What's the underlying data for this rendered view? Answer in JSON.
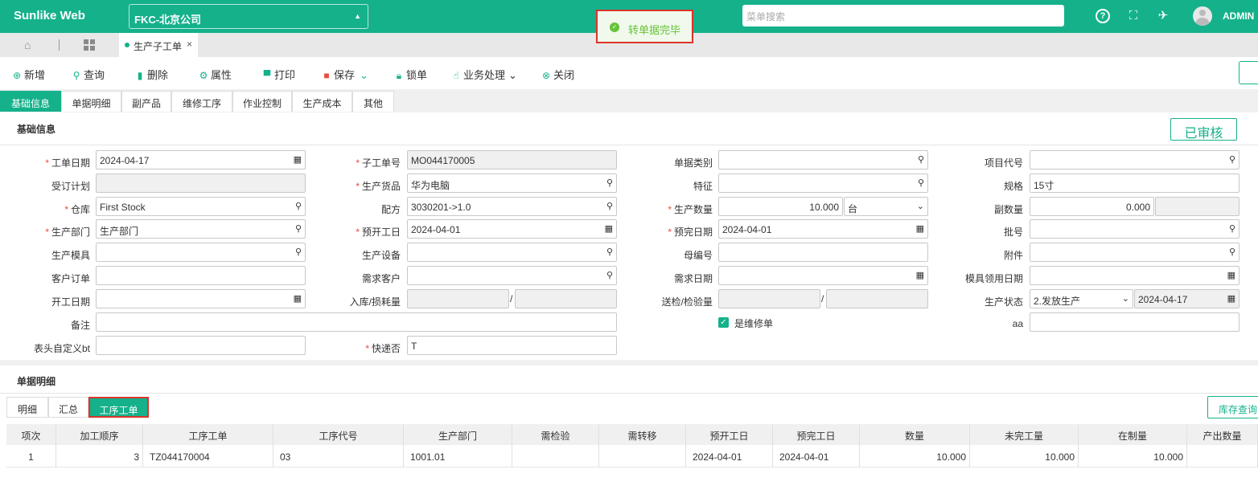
{
  "header": {
    "brand": "Sunlike Web",
    "company": "FKC-北京公司",
    "toast": "转单据完毕",
    "menu_search_placeholder": "菜单搜索",
    "user": "ADMIN",
    "icons": [
      "help-icon",
      "fullscreen-icon",
      "broom-icon",
      "user-avatar"
    ]
  },
  "page_tab": {
    "label": "生产子工单"
  },
  "toolbar": {
    "new": "新增",
    "query": "查询",
    "delete": "删除",
    "properties": "属性",
    "print": "打印",
    "save": "保存",
    "lock": "锁单",
    "business": "业务处理",
    "close": "关闭"
  },
  "tabs": [
    "基础信息",
    "单据明细",
    "副产品",
    "维修工序",
    "作业控制",
    "生产成本",
    "其他"
  ],
  "basic": {
    "section_title": "基础信息",
    "status_badge": "已审核",
    "labels": {
      "order_date": "工单日期",
      "sub_order_no": "子工单号",
      "doc_type": "单据类别",
      "project_code": "项目代号",
      "order_plan": "受订计划",
      "product": "生产货品",
      "feature": "特征",
      "spec": "规格",
      "warehouse": "仓库",
      "recipe": "配方",
      "prod_qty": "生产数量",
      "sub_qty": "副数量",
      "dept": "生产部门",
      "planned_start": "预开工日",
      "planned_finish": "预完日期",
      "batch": "批号",
      "mold": "生产模具",
      "equipment": "生产设备",
      "parent_no": "母编号",
      "attachment": "附件",
      "cust_order": "客户订单",
      "demand_cust": "需求客户",
      "demand_date": "需求日期",
      "mold_date": "模具领用日期",
      "start_date": "开工日期",
      "in_loss": "入库/损耗量",
      "inspect": "送检/检验量",
      "prod_status": "生产状态",
      "remark": "备注",
      "is_repair": "是维修单",
      "aa": "aa",
      "header_custom": "表头自定义bt",
      "express": "快递否"
    },
    "values": {
      "order_date": "2024-04-17",
      "sub_order_no": "MO044170005",
      "product": "华为电脑",
      "spec": "15寸",
      "warehouse": "First Stock",
      "recipe": "3030201->1.0",
      "prod_qty": "10.000",
      "unit": "台",
      "sub_qty": "0.000",
      "dept": "生产部门",
      "planned_start": "2024-04-01",
      "planned_finish": "2024-04-01",
      "prod_status": "2.发放生产",
      "status_date": "2024-04-17",
      "express": "T",
      "is_repair": true
    }
  },
  "detail": {
    "section_title": "单据明细",
    "subtabs": [
      "明细",
      "汇总",
      "工序工单"
    ],
    "stock_button": "库存查询",
    "columns": [
      "项次",
      "加工顺序",
      "工序工单",
      "工序代号",
      "生产部门",
      "需检验",
      "需转移",
      "预开工日",
      "预完工日",
      "数量",
      "未完工量",
      "在制量",
      "产出数量"
    ],
    "rows": [
      [
        "1",
        "3",
        "TZ044170004",
        "03",
        "1001.01",
        "",
        "",
        "2024-04-01",
        "2024-04-01",
        "10.000",
        "10.000",
        "10.000",
        ""
      ]
    ]
  }
}
